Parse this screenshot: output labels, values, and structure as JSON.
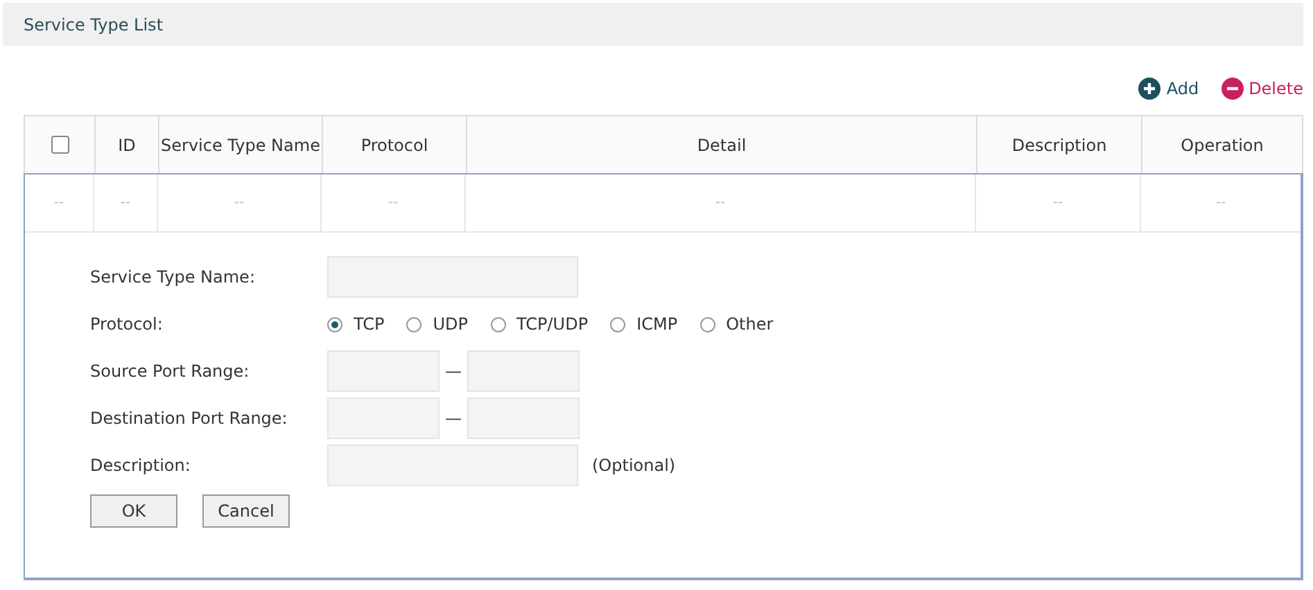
{
  "panel": {
    "title": "Service Type List"
  },
  "actions": [
    {
      "kind": "add",
      "label": "Add"
    },
    {
      "kind": "delete",
      "label": "Delete"
    }
  ],
  "table": {
    "select_all": {
      "checked": false
    },
    "columns": [
      {
        "kind": "checkbox"
      },
      {
        "kind": "text",
        "label": "ID"
      },
      {
        "kind": "text",
        "label": "Service Type Name"
      },
      {
        "kind": "text",
        "label": "Protocol"
      },
      {
        "kind": "text",
        "label": "Detail"
      },
      {
        "kind": "text",
        "label": "Description"
      },
      {
        "kind": "text",
        "label": "Operation"
      }
    ],
    "rows": [
      {
        "cells": [
          "--",
          "--",
          "--",
          "--",
          "--",
          "--",
          "--"
        ]
      }
    ]
  },
  "form": {
    "fields": [
      {
        "kind": "text",
        "label": "Service Type Name:"
      },
      {
        "kind": "radio",
        "label": "Protocol:",
        "options": [
          {
            "label": "TCP",
            "selected": true
          },
          {
            "label": "UDP",
            "selected": false
          },
          {
            "label": "TCP/UDP",
            "selected": false
          },
          {
            "label": "ICMP",
            "selected": false
          },
          {
            "label": "Other",
            "selected": false
          }
        ]
      },
      {
        "kind": "range",
        "label": "Source Port Range:",
        "separator": "—"
      },
      {
        "kind": "range",
        "label": "Destination Port Range:",
        "separator": "—"
      },
      {
        "kind": "text",
        "label": "Description:",
        "note": "(Optional)"
      }
    ],
    "buttons": [
      "OK",
      "Cancel"
    ]
  }
}
